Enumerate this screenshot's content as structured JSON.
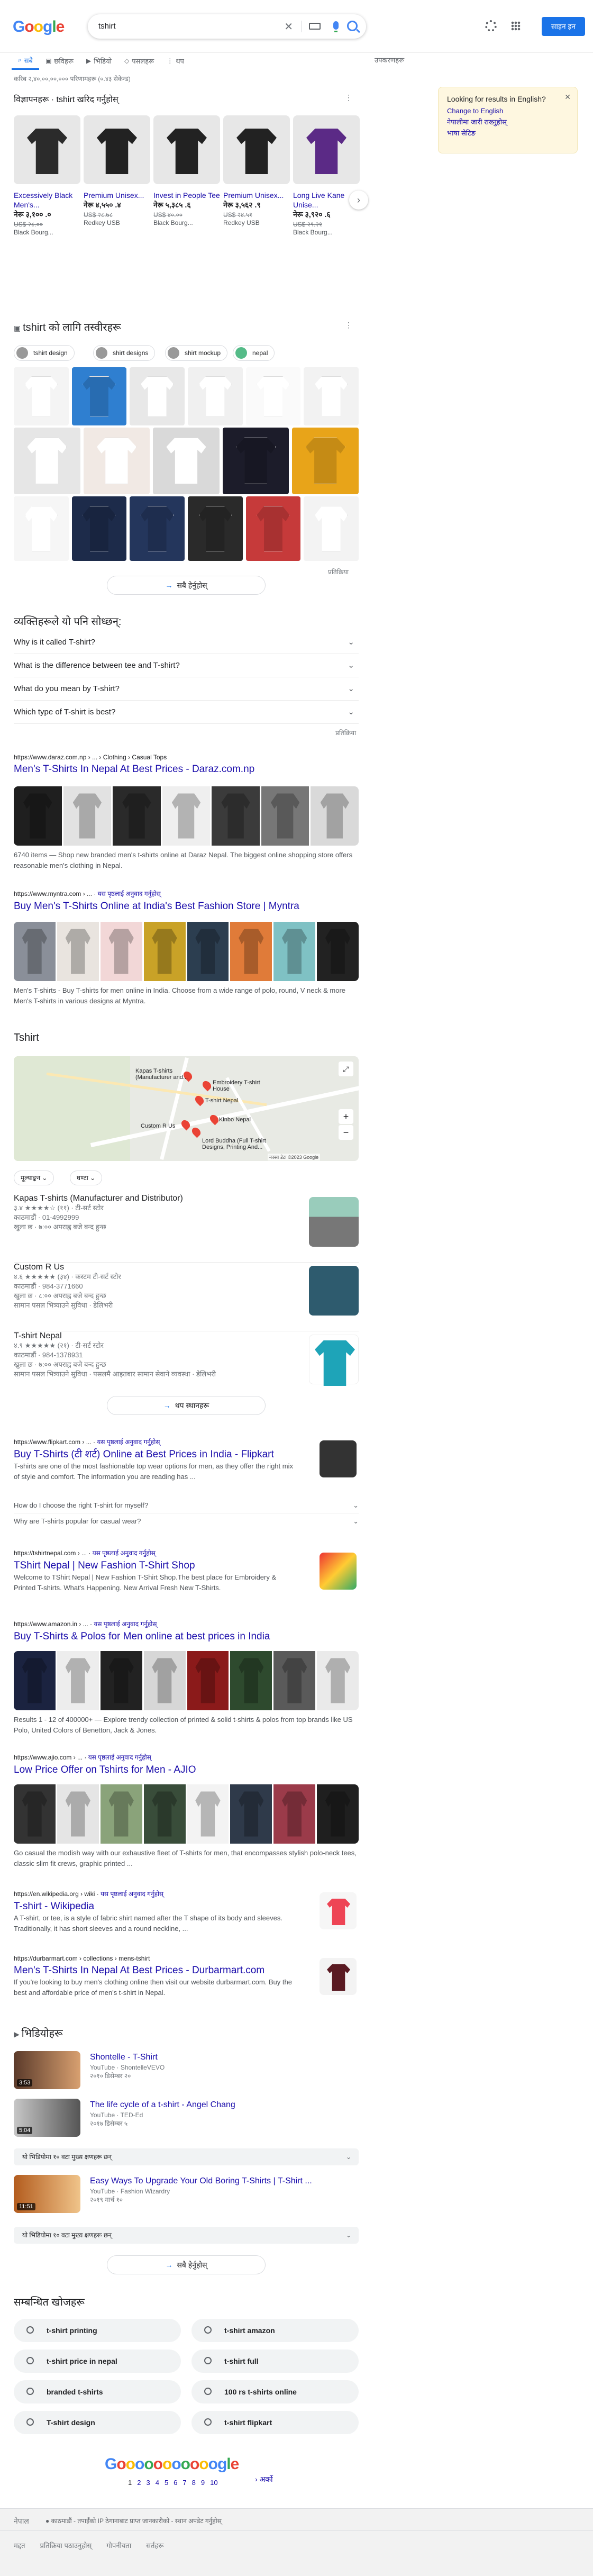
{
  "header": {
    "logo": "Google",
    "query": "tshirt",
    "signin": "साइन इन गर्नुहोस्"
  },
  "tabs": [
    {
      "label": "सबै",
      "icon": "search-icon"
    },
    {
      "label": "छविहरू",
      "icon": "image-icon"
    },
    {
      "label": "भिडियो",
      "icon": "video-icon"
    },
    {
      "label": "पसलहरू",
      "icon": "tag-icon"
    },
    {
      "label": "थप",
      "icon": "more-icon"
    }
  ],
  "tools": "उपकरणहरू",
  "stats": "करिब २,४०,००,००,००० परिणामहरू (०.४३ सेकेन्ड)",
  "shopping": {
    "heading": "विज्ञापनहरू · tshirt खरिद गर्नुहोस्",
    "products": [
      {
        "name": "Excessively Black Men's...",
        "price": "नेरू ३,१०० .०",
        "old": "US$ २८.००",
        "seller": "Black Bourg..."
      },
      {
        "name": "Premium Unisex...",
        "price": "नेरू ४,५५० .४",
        "old": "US$ २८.७८",
        "seller": "Redkey USB"
      },
      {
        "name": "Invest in People Tee",
        "price": "नेरू ५,३८५ .६",
        "old": "US$ ४०.००",
        "seller": "Black Bourg..."
      },
      {
        "name": "Premium Unisex...",
        "price": "नेरू ३,५६२ .९",
        "old": "US$ २४.५१",
        "seller": "Redkey USB"
      },
      {
        "name": "Long Live Kane Unise...",
        "price": "नेरू ३,९२० .६",
        "old": "US$ २९.२१",
        "seller": "Black Bourg..."
      }
    ]
  },
  "lang_panel": {
    "title": "Looking for results in English?",
    "l1": "Change to English",
    "l2": "नेपालीमा जारी राख्नुहोस्",
    "l3": "भाषा सेटिङ"
  },
  "images": {
    "heading": "tshirt को लागि तस्वीरहरू",
    "chips": [
      "tshirt design",
      "shirt designs",
      "shirt mockup",
      "nepal"
    ],
    "feedback": "प्रतिक्रिया",
    "more": "सबै हेर्नुहोस्"
  },
  "paa": {
    "heading": "व्यक्तिहरूले यो पनि सोध्छन्:",
    "items": [
      "Why is it called T-shirt?",
      "What is the difference between tee and T-shirt?",
      "What do you mean by T-shirt?",
      "Which type of T-shirt is best?"
    ],
    "feedback": "प्रतिक्रिया"
  },
  "r1": {
    "url": "https://www.daraz.com.np › ... › Clothing › Casual Tops",
    "title": "Men's T-Shirts In Nepal At Best Prices - Daraz.com.np",
    "snippet": "6740 items — Shop new branded men's t-shirts online at Daraz Nepal. The biggest online shopping store offers reasonable men's clothing in Nepal."
  },
  "r2": {
    "url": "https://www.myntra.com › ...",
    "translate": "यस पृष्ठलाई अनुवाद गर्नुहोस्",
    "title": "Buy Men's T-Shirts Online at India's Best Fashion Store | Myntra",
    "snippet": "Men's T-shirts - Buy T-shirts for men online in India. Choose from a wide range of polo, round, V neck & more Men's T-shirts in various designs at Myntra."
  },
  "local": {
    "heading": "Tshirt",
    "chips": [
      "मूल्याङ्कन",
      "घण्टा"
    ],
    "places": [
      {
        "name": "Kapas T-shirts (Manufacturer and Distributor)",
        "rating": "३.४ ★★★★☆ (११) · टी-सर्ट स्टोर",
        "addr": "काठमाडौं · 01-4992999",
        "hours": "खुला छ · ७:०० अपराह्न बजे बन्द हुन्छ"
      },
      {
        "name": "Custom R Us",
        "rating": "४.६ ★★★★★ (३४) · कस्टम टी-सर्ट स्टोर",
        "addr": "काठमाडौं · 984-3771660",
        "hours": "खुला छ · ८:०० अपराह्न बजे बन्द हुन्छ",
        "note": "सामान पसल भित्र्याउने सुविधा · डेलिभरी"
      },
      {
        "name": "T-shirt Nepal",
        "rating": "४.९ ★★★★★ (२१) · टी-सर्ट स्टोर",
        "addr": "काठमाडौं · 984-1378931",
        "hours": "खुला छ · ७:०० अपराह्न बजे बन्द हुन्छ",
        "note": "सामान पसल भित्र्याउने सुविधा · पसलमै आइतबार सामान सेवाने व्यवस्था · डेलिभरी"
      }
    ],
    "more": "थप स्थानहरू",
    "map_labels": [
      "Kapas T-shirts (Manufacturer and...",
      "Embroidery T-shirt House",
      "T-shirt Nepal",
      "Custom R Us",
      "Kinbo Nepal",
      "Lord Buddha (Full T-shirt Designs, Printing And..."
    ],
    "map_credit": "नक्सा डेटा ©2023 Google"
  },
  "r3": {
    "url": "https://www.flipkart.com › ...",
    "translate": "यस पृष्ठलाई अनुवाद गर्नुहोस्",
    "title": "Buy T-Shirts (टी शर्ट) Online at Best Prices in India - Flipkart",
    "snippet": "T-shirts are one of the most fashionable top wear options for men, as they offer the right mix of style and comfort. The information you are reading has ...",
    "q1": "How do I choose the right T-shirt for myself?",
    "q2": "Why are T-shirts popular for casual wear?"
  },
  "r4": {
    "url": "https://tshirtnepal.com › ...",
    "translate": "यस पृष्ठलाई अनुवाद गर्नुहोस्",
    "title": "TShirt Nepal | New Fashion T-Shirt Shop",
    "snippet": "Welcome to TShirt Nepal | New Fashion T-Shirt Shop.The best place for Embroidery & Printed T-shirts. What's Happening. New Arrival Fresh New T-Shirts."
  },
  "r5": {
    "url": "https://www.amazon.in › ...",
    "translate": "यस पृष्ठलाई अनुवाद गर्नुहोस्",
    "title": "Buy T-Shirts & Polos for Men online at best prices in India",
    "snippet": "Results 1 - 12 of 400000+ — Explore trendy collection of printed & solid t-shirts & polos from top brands like US Polo, United Colors of Benetton, Jack & Jones."
  },
  "r6": {
    "url": "https://www.ajio.com › ...",
    "translate": "यस पृष्ठलाई अनुवाद गर्नुहोस्",
    "title": "Low Price Offer on Tshirts for Men - AJIO",
    "snippet": "Go casual the modish way with our exhaustive fleet of T-shirts for men, that encompasses stylish polo-neck tees, classic slim fit crews, graphic printed ..."
  },
  "r7": {
    "url": "https://en.wikipedia.org › wiki",
    "translate": "यस पृष्ठलाई अनुवाद गर्नुहोस्",
    "title": "T-shirt - Wikipedia",
    "snippet": "A T-shirt, or tee, is a style of fabric shirt named after the T shape of its body and sleeves. Traditionally, it has short sleeves and a round neckline, ..."
  },
  "r8": {
    "url": "https://durbarmart.com › collections › mens-tshirt",
    "title": "Men's T-Shirts In Nepal At Best Prices - Durbarmart.com",
    "snippet": "If you're looking to buy men's clothing online then visit our website durbarmart.com. Buy the best and affordable price of men's t-shirt in Nepal."
  },
  "videos": {
    "heading": "भिडियोहरू",
    "items": [
      {
        "title": "Shontelle - T-Shirt",
        "src": "YouTube · ShontelleVEVO",
        "date": "२०१० डिसेम्बर २०",
        "dur": "3:53"
      },
      {
        "title": "The life cycle of a t-shirt - Angel Chang",
        "src": "YouTube · TED-Ed",
        "date": "२०१७ डिसेम्बर ५",
        "dur": "5:04"
      },
      {
        "title": "Easy Ways To Upgrade Your Old Boring T-Shirts | T-Shirt ...",
        "src": "YouTube · Fashion Wizardry",
        "date": "२०१९ मार्च १०",
        "dur": "11:51"
      }
    ],
    "key": "यो भिडियोमा १० वटा मुख्य क्षणहरू छन्",
    "more": "सबै हेर्नुहोस्"
  },
  "related": {
    "heading": "सम्बन्धित खोजहरू",
    "items": [
      "t-shirt printing",
      "t-shirt amazon",
      "t-shirt price in nepal",
      "t-shirt full",
      "branded t-shirts",
      "100 rs t-shirts online",
      "T-shirt design",
      "t-shirt flipkart"
    ]
  },
  "pager": {
    "logo": "Gooooooooooogle",
    "pages": [
      "1",
      "2",
      "3",
      "4",
      "5",
      "6",
      "7",
      "8",
      "9",
      "10"
    ],
    "next": "अर्को"
  },
  "footer": {
    "country": "नेपाल",
    "loc": "● काठमाडौं - तपाईँको IP ठेगानाबाट प्राप्त जानकारीको - स्थान अपडेट गर्नुहोस्",
    "links": [
      "मद्दत",
      "प्रतिक्रिया पठाउनुहोस्",
      "गोपनीयता",
      "सर्तहरू"
    ]
  }
}
